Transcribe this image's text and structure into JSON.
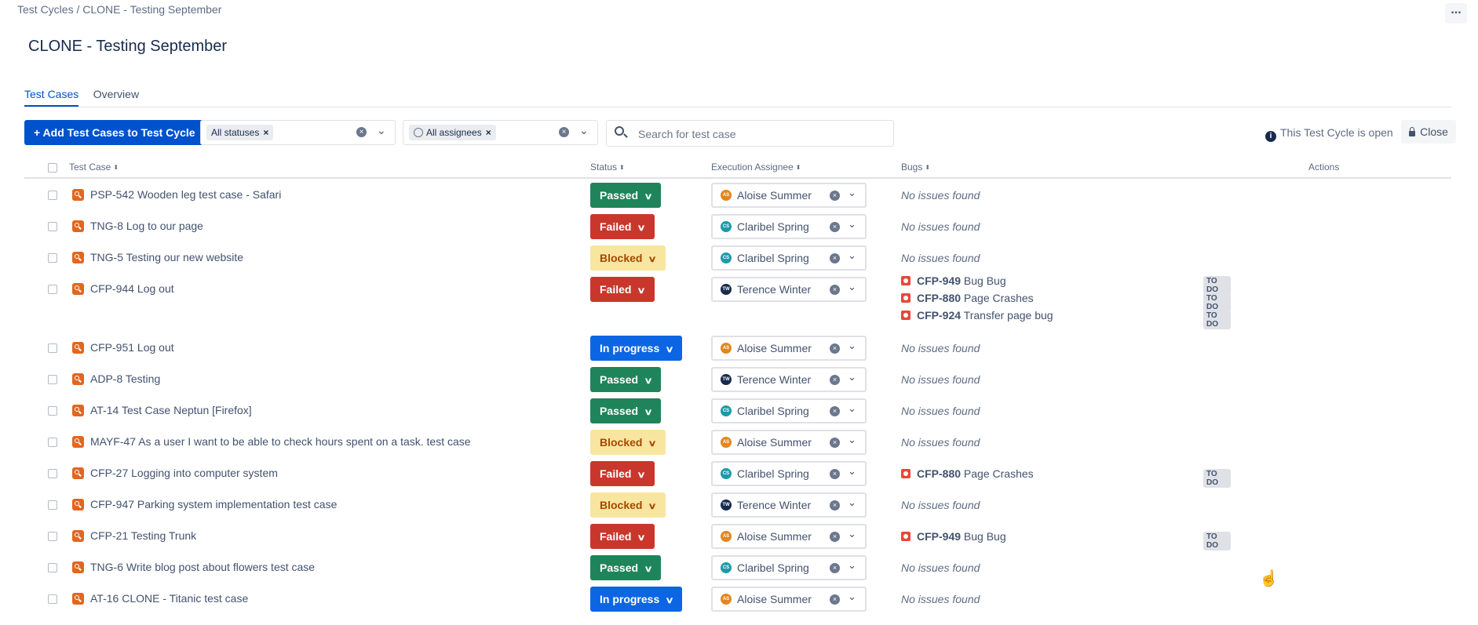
{
  "breadcrumb": "Test Cycles / CLONE - Testing September",
  "more_label": "...",
  "page_title": "CLONE - Testing September",
  "tabs": [
    {
      "label": "Test Cases",
      "active": true
    },
    {
      "label": "Overview",
      "active": false
    }
  ],
  "toolbar": {
    "add_button": "+ Add Test Cases to Test Cycle",
    "status_filter": "All statuses",
    "assignee_filter": "All assignees",
    "search_placeholder": "Search for test case",
    "cycle_status": "This Test Cycle is open",
    "close_button": "Close"
  },
  "columns": {
    "test_case": "Test Case",
    "status": "Status",
    "assignee": "Execution Assignee",
    "bugs": "Bugs",
    "actions": "Actions"
  },
  "no_issues_text": "No issues found",
  "status_colors": {
    "Passed": {
      "bg": "#1f845a",
      "fg": "#ffffff"
    },
    "Failed": {
      "bg": "#c9372c",
      "fg": "#ffffff"
    },
    "Blocked": {
      "bg": "#f8e6a0",
      "fg": "#a54800"
    },
    "In progress": {
      "bg": "#0c66e4",
      "fg": "#ffffff"
    }
  },
  "assignees": {
    "Aloise Summer": {
      "initials": "AS",
      "color": "#e2861f"
    },
    "Claribel Spring": {
      "initials": "CS",
      "color": "#1d9aaa"
    },
    "Terence Winter": {
      "initials": "TW",
      "color": "#172b4d"
    }
  },
  "rows": [
    {
      "key": "PSP-542",
      "title": "Wooden leg test case - Safari",
      "status": "Passed",
      "assignee": "Aloise Summer",
      "bugs": []
    },
    {
      "key": "TNG-8",
      "title": "Log to our page",
      "status": "Failed",
      "assignee": "Claribel Spring",
      "bugs": []
    },
    {
      "key": "TNG-5",
      "title": "Testing our new website",
      "status": "Blocked",
      "assignee": "Claribel Spring",
      "bugs": []
    },
    {
      "key": "CFP-944",
      "title": "Log out",
      "status": "Failed",
      "assignee": "Terence Winter",
      "bugs": [
        {
          "key": "CFP-949",
          "title": "Bug Bug",
          "state": "TO DO"
        },
        {
          "key": "CFP-880",
          "title": "Page Crashes",
          "state": "TO DO"
        },
        {
          "key": "CFP-924",
          "title": "Transfer page bug",
          "state": "TO DO"
        }
      ]
    },
    {
      "key": "CFP-951",
      "title": "Log out",
      "status": "In progress",
      "assignee": "Aloise Summer",
      "bugs": []
    },
    {
      "key": "ADP-8",
      "title": "Testing",
      "status": "Passed",
      "assignee": "Terence Winter",
      "bugs": []
    },
    {
      "key": "AT-14",
      "title": "Test Case Neptun [Firefox]",
      "status": "Passed",
      "assignee": "Claribel Spring",
      "bugs": []
    },
    {
      "key": "MAYF-47",
      "title": "As a user I want to be able to check hours spent on a task. test case",
      "status": "Blocked",
      "assignee": "Aloise Summer",
      "bugs": []
    },
    {
      "key": "CFP-27",
      "title": "Logging into computer system",
      "status": "Failed",
      "assignee": "Claribel Spring",
      "bugs": [
        {
          "key": "CFP-880",
          "title": "Page Crashes",
          "state": "TO DO"
        }
      ]
    },
    {
      "key": "CFP-947",
      "title": "Parking system implementation test case",
      "status": "Blocked",
      "assignee": "Terence Winter",
      "bugs": []
    },
    {
      "key": "CFP-21",
      "title": "Testing Trunk",
      "status": "Failed",
      "assignee": "Aloise Summer",
      "bugs": [
        {
          "key": "CFP-949",
          "title": "Bug Bug",
          "state": "TO DO"
        }
      ]
    },
    {
      "key": "TNG-6",
      "title": "Write blog post about flowers test case",
      "status": "Passed",
      "assignee": "Claribel Spring",
      "bugs": []
    },
    {
      "key": "AT-16",
      "title": "CLONE - Titanic test case",
      "status": "In progress",
      "assignee": "Aloise Summer",
      "bugs": []
    }
  ]
}
